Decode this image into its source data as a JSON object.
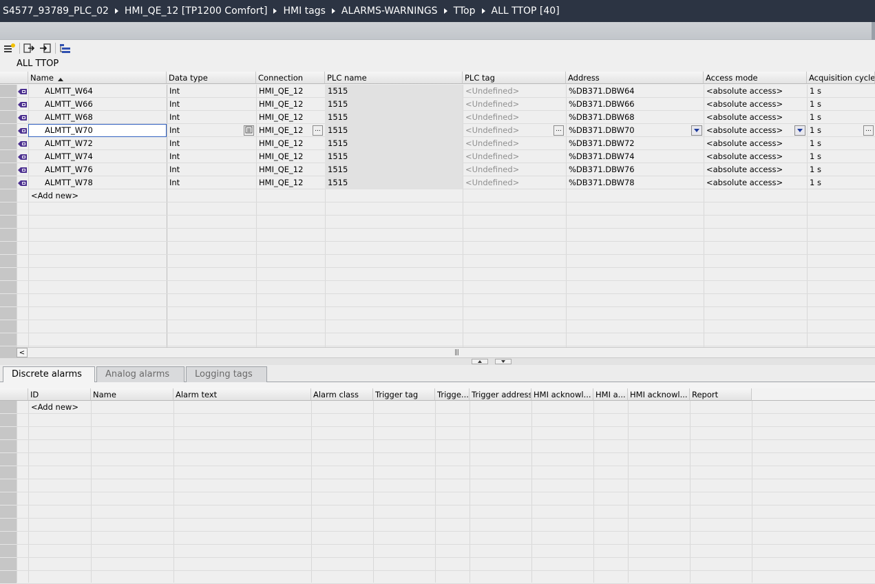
{
  "breadcrumb": [
    "S4577_93789_PLC_02",
    "HMI_QE_12 [TP1200 Comfort]",
    "HMI tags",
    "ALARMS-WARNINGS",
    "TTop",
    "ALL TTOP [40]"
  ],
  "table_title": "ALL TTOP",
  "columns": [
    "Name",
    "Data type",
    "Connection",
    "PLC name",
    "PLC tag",
    "Address",
    "Access mode",
    "Acquisition cycle"
  ],
  "rows": [
    {
      "name": "ALMTT_W64",
      "type": "Int",
      "connection": "HMI_QE_12",
      "plc_name": "1515",
      "plc_tag": "<Undefined>",
      "address": "%DB371.DBW64",
      "access": "<absolute access>",
      "cycle": "1 s"
    },
    {
      "name": "ALMTT_W66",
      "type": "Int",
      "connection": "HMI_QE_12",
      "plc_name": "1515",
      "plc_tag": "<Undefined>",
      "address": "%DB371.DBW66",
      "access": "<absolute access>",
      "cycle": "1 s"
    },
    {
      "name": "ALMTT_W68",
      "type": "Int",
      "connection": "HMI_QE_12",
      "plc_name": "1515",
      "plc_tag": "<Undefined>",
      "address": "%DB371.DBW68",
      "access": "<absolute access>",
      "cycle": "1 s"
    },
    {
      "name": "ALMTT_W70",
      "type": "Int",
      "connection": "HMI_QE_12",
      "plc_name": "1515",
      "plc_tag": "<Undefined>",
      "address": "%DB371.DBW70",
      "access": "<absolute access>",
      "cycle": "1 s"
    },
    {
      "name": "ALMTT_W72",
      "type": "Int",
      "connection": "HMI_QE_12",
      "plc_name": "1515",
      "plc_tag": "<Undefined>",
      "address": "%DB371.DBW72",
      "access": "<absolute access>",
      "cycle": "1 s"
    },
    {
      "name": "ALMTT_W74",
      "type": "Int",
      "connection": "HMI_QE_12",
      "plc_name": "1515",
      "plc_tag": "<Undefined>",
      "address": "%DB371.DBW74",
      "access": "<absolute access>",
      "cycle": "1 s"
    },
    {
      "name": "ALMTT_W76",
      "type": "Int",
      "connection": "HMI_QE_12",
      "plc_name": "1515",
      "plc_tag": "<Undefined>",
      "address": "%DB371.DBW76",
      "access": "<absolute access>",
      "cycle": "1 s"
    },
    {
      "name": "ALMTT_W78",
      "type": "Int",
      "connection": "HMI_QE_12",
      "plc_name": "1515",
      "plc_tag": "<Undefined>",
      "address": "%DB371.DBW78",
      "access": "<absolute access>",
      "cycle": "1 s"
    }
  ],
  "add_new": "<Add new>",
  "tabs": [
    "Discrete alarms",
    "Analog alarms",
    "Logging tags"
  ],
  "alarm_columns": [
    "ID",
    "Name",
    "Alarm text",
    "Alarm class",
    "Trigger tag",
    "Trigge...",
    "Trigger address",
    "HMI acknowl...",
    "HMI a...",
    "HMI acknowl...",
    "Report"
  ],
  "alarm_add_new": "<Add new>",
  "scroll_left": "<",
  "scroll_grip": "|||",
  "ellipsis": "...",
  "colors": {
    "breadcrumb_bg": "#2c3443",
    "selected_border": "#3060c0",
    "tag_icon": "#4b2f8f"
  }
}
